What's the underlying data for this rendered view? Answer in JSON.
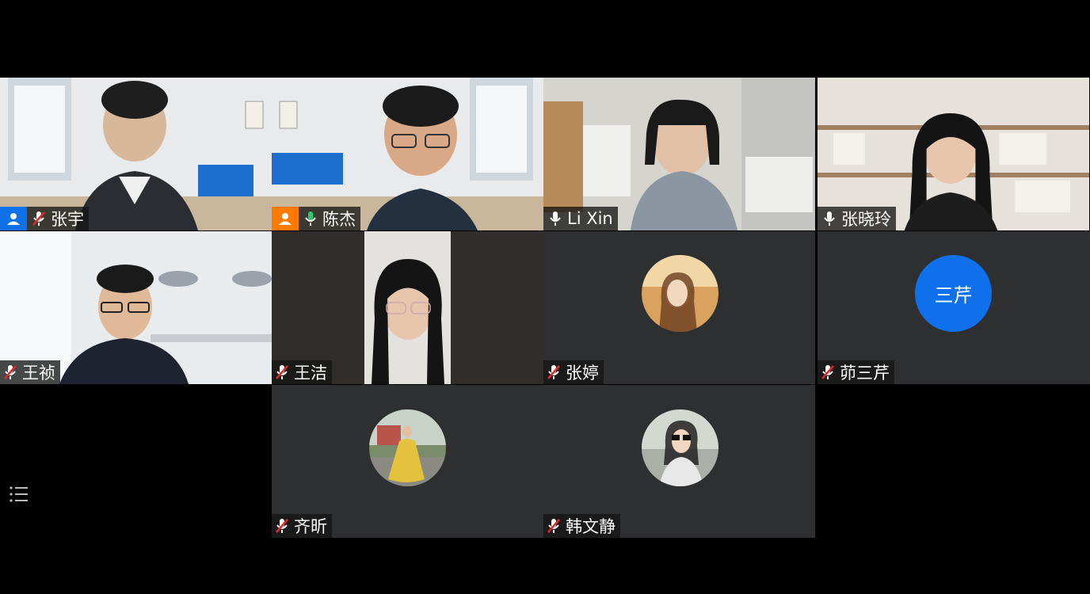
{
  "participants": [
    {
      "name": "张宇",
      "mic": "muted",
      "host": true,
      "video": "on"
    },
    {
      "name": "陈杰",
      "mic": "active",
      "host": true,
      "video": "on",
      "speaking": true
    },
    {
      "name": "Li Xin",
      "mic": "on",
      "host": false,
      "video": "on"
    },
    {
      "name": "张晓玲",
      "mic": "on",
      "host": false,
      "video": "on"
    },
    {
      "name": "王祯",
      "mic": "muted",
      "host": false,
      "video": "on"
    },
    {
      "name": "王洁",
      "mic": "muted",
      "host": false,
      "video": "on"
    },
    {
      "name": "张婷",
      "mic": "muted",
      "host": false,
      "video": "off",
      "avatar": "photo"
    },
    {
      "name": "茆三芹",
      "mic": "muted",
      "host": false,
      "video": "off",
      "avatar": "initials",
      "initials": "三芹",
      "avatar_color": "#0e71eb"
    },
    {
      "name": "齐昕",
      "mic": "muted",
      "host": false,
      "video": "off",
      "avatar": "photo"
    },
    {
      "name": "韩文静",
      "mic": "muted",
      "host": false,
      "video": "off",
      "avatar": "photo"
    }
  ],
  "colors": {
    "host_badge_blue": "#0e71eb",
    "host_badge_orange": "#ff7a00",
    "speaking_green": "#2ecc71",
    "muted_red": "#e02828",
    "tile_bg": "#2e2f31"
  },
  "icons": {
    "host": "person-icon",
    "mic_on": "microphone-icon",
    "mic_muted": "microphone-muted-icon",
    "list": "list-icon"
  }
}
